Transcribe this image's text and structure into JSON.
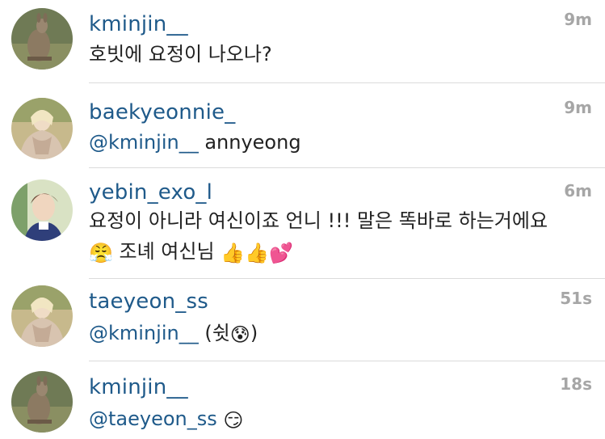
{
  "comments": [
    {
      "username": "kminjin__",
      "time": "9m",
      "text": "호빗에 요정이 나오나?",
      "avatar": "kangaroo-photo"
    },
    {
      "username": "baekyeonnie_",
      "time": "9m",
      "mention": "@kminjin__",
      "text": " annyeong",
      "avatar": "woman-with-scarf-photo"
    },
    {
      "username": "yebin_exo_l",
      "time": "6m",
      "line1": "요정이 아니라 여신이죠 언니 !!! 말은 똑바로 하는거에요",
      "emoji_angry": "😤",
      "line2_text": " 조녜 여신님 ",
      "emoji_thumb1": "👍",
      "emoji_thumb2": "👍",
      "emoji_hearts": "💕",
      "avatar": "young-man-photo"
    },
    {
      "username": "taeyeon_ss",
      "time": "51s",
      "mention": "@kminjin__",
      "text_open": " (쉿",
      "emoji_sweat": "😰",
      "text_close": ")",
      "avatar": "woman-with-scarf-photo"
    },
    {
      "username": "kminjin__",
      "time": "18s",
      "mention": "@taeyeon_ss",
      "emoji_smirk": "😏",
      "avatar": "kangaroo-photo"
    }
  ],
  "colors": {
    "username": "#1f5a8a",
    "text": "#222222",
    "time": "#a6a6a6",
    "divider": "#dbdbdb"
  }
}
